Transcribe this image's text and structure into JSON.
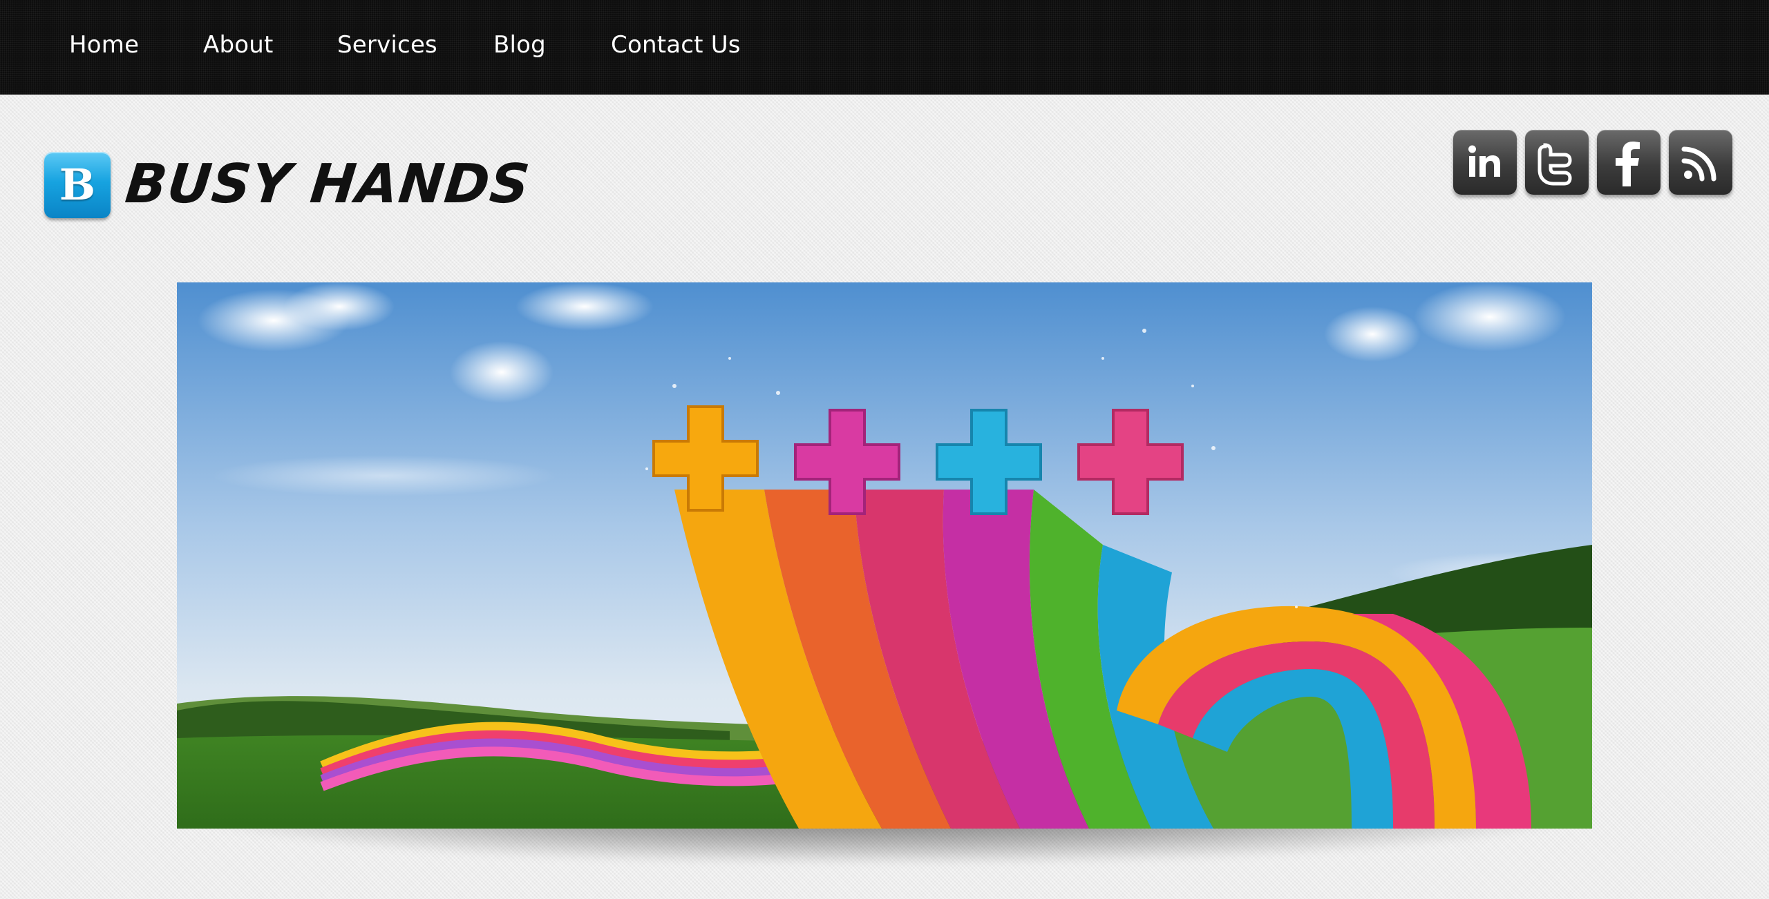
{
  "nav": {
    "items": [
      {
        "label": "Home"
      },
      {
        "label": "About"
      },
      {
        "label": "Services"
      },
      {
        "label": "Blog"
      },
      {
        "label": "Contact Us"
      }
    ]
  },
  "brand": {
    "badge_letter": "B",
    "name": "BUSY HANDS",
    "badge_color": "#17a3e0"
  },
  "social": [
    {
      "icon": "linkedin-icon"
    },
    {
      "icon": "twitter-icon"
    },
    {
      "icon": "facebook-icon"
    },
    {
      "icon": "rss-icon"
    }
  ],
  "hero": {
    "description_icon": "hero-banner-image"
  },
  "colors": {
    "nav_bg": "#0d0d0d",
    "page_bg": "#ececec",
    "social_bg": "#3c3c3c"
  }
}
